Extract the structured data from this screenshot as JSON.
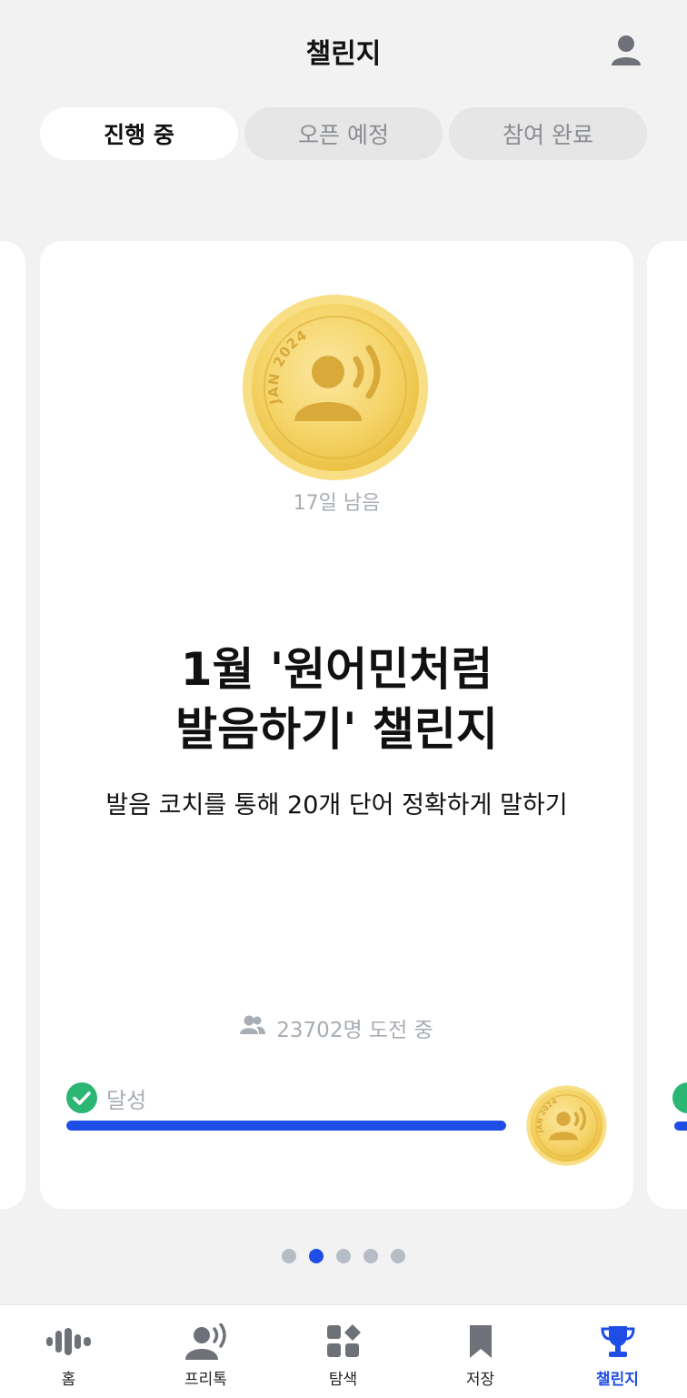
{
  "header": {
    "title": "챌린지",
    "profile_icon": "user-icon"
  },
  "tabs": [
    {
      "label": "진행 중",
      "active": true
    },
    {
      "label": "오픈 예정",
      "active": false
    },
    {
      "label": "참여 완료",
      "active": false
    }
  ],
  "card": {
    "badge_text": "JAN 2024",
    "days_left": "17일 남음",
    "title_line1": "1월 '원어민처럼",
    "title_line2": "발음하기' 챌린지",
    "subtitle": "발음 코치를 통해 20개 단어 정확하게 말하기",
    "participants": "23702명 도전 중",
    "participants_icon": "people-icon",
    "achieve_label": "달성",
    "achieve_icon": "check-circle-icon",
    "progress_percent": 100
  },
  "pagination": {
    "total": 5,
    "active_index": 1
  },
  "bottom_nav": [
    {
      "label": "홈",
      "icon": "waveform-icon",
      "active": false
    },
    {
      "label": "프리톡",
      "icon": "speaking-person-icon",
      "active": false
    },
    {
      "label": "탐색",
      "icon": "grid-icon",
      "active": false
    },
    {
      "label": "저장",
      "icon": "bookmark-icon",
      "active": false
    },
    {
      "label": "챌린지",
      "icon": "trophy-icon",
      "active": true
    }
  ],
  "colors": {
    "accent": "#1f4de8",
    "success": "#2bb673",
    "muted": "#a8adb4",
    "coin": "#f3d060"
  }
}
